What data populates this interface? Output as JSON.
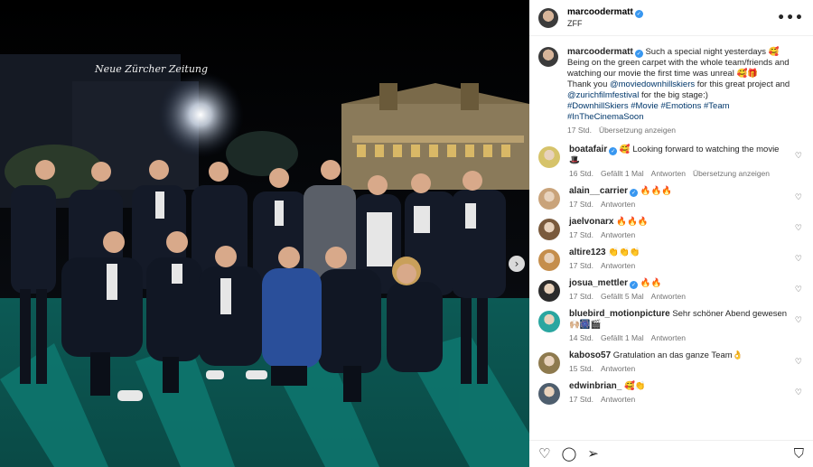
{
  "post": {
    "username": "marcoodermatt",
    "location": "ZFF",
    "caption_lines": [
      "Such a special night yesterdays 🥰",
      "Being on the green carpet with the whole team/friends and watching our movie the first time was unreal 🥰🎁",
      "Thank you "
    ],
    "caption_link1": "@moviedownhillskiers",
    "caption_mid": " for this great project and ",
    "caption_link2": "@zurichfilmfestival",
    "caption_end": " for the big stage:)",
    "hashtags": "#DownhillSkiers #Movie #Emotions #Team #InTheCinemaSoon",
    "time": "17 Std.",
    "translate": "Übersetzung anzeigen"
  },
  "photo": {
    "sign_text": "Neue Zürcher Zeitung"
  },
  "comments": [
    {
      "user": "boatafair",
      "verified": true,
      "text": "🥰 Looking forward to watching the movie 🎩",
      "time": "16 Std.",
      "likes": "Gefällt 1 Mal",
      "reply": "Antworten",
      "translate": "Übersetzung anzeigen",
      "color": "#d6c36a"
    },
    {
      "user": "alain__carrier",
      "verified": true,
      "text": "🔥🔥🔥",
      "time": "17 Std.",
      "likes": "",
      "reply": "Antworten",
      "translate": "",
      "color": "#c9a37a"
    },
    {
      "user": "jaelvonarx",
      "verified": false,
      "text": "🔥🔥🔥",
      "time": "17 Std.",
      "likes": "",
      "reply": "Antworten",
      "translate": "",
      "color": "#7a5a3c"
    },
    {
      "user": "altire123",
      "verified": false,
      "text": "👏👏👏",
      "time": "17 Std.",
      "likes": "",
      "reply": "Antworten",
      "translate": "",
      "color": "#c58e4c"
    },
    {
      "user": "josua_mettler",
      "verified": true,
      "text": "🔥🔥",
      "time": "17 Std.",
      "likes": "Gefällt 5 Mal",
      "reply": "Antworten",
      "translate": "",
      "color": "#2b2b2b"
    },
    {
      "user": "bluebird_motionpicture",
      "verified": false,
      "text": "Sehr schöner Abend gewesen 🙌🏼🎆🎬",
      "time": "14 Std.",
      "likes": "Gefällt 1 Mal",
      "reply": "Antworten",
      "translate": "",
      "color": "#2aa6a0"
    },
    {
      "user": "kaboso57",
      "verified": false,
      "text": "Gratulation an das ganze Team👌",
      "time": "15 Std.",
      "likes": "",
      "reply": "Antworten",
      "translate": "",
      "color": "#8e7a4e"
    },
    {
      "user": "edwinbrian_",
      "verified": false,
      "text": "🥰👏",
      "time": "17 Std.",
      "likes": "",
      "reply": "Antworten",
      "translate": "",
      "color": "#4e5e6e"
    }
  ]
}
